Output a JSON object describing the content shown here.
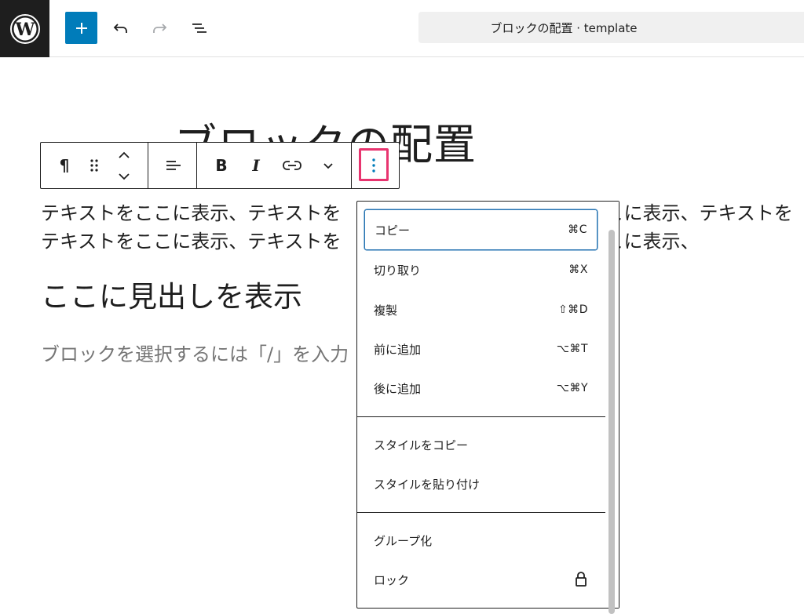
{
  "topbar": {
    "doc_title": "ブロックの配置 · template",
    "icons": [
      "wordpress-logo-icon",
      "plus-icon",
      "undo-icon",
      "redo-icon",
      "list-view-icon"
    ]
  },
  "canvas": {
    "post_title": "ブロックの配置",
    "paragraph_line1": "テキストをここに表示、テキストを　　　　　　　　　　　　　　こに表示、テキストを",
    "paragraph_line2": "テキストをここに表示、テキストを　　　　　　　　　　　　　　こに表示、",
    "heading": "ここに見出しを表示",
    "placeholder": "ブロックを選択するには「/」を入力"
  },
  "block_toolbar": {
    "paragraph_symbol": "¶",
    "bold": "B",
    "italic": "I",
    "icons": [
      "paragraph-icon",
      "drag-handle-icon",
      "move-up-icon",
      "move-down-icon",
      "align-icon",
      "link-icon",
      "chevron-down-icon",
      "more-options-icon"
    ]
  },
  "menu": {
    "group1": [
      {
        "label": "コピー",
        "shortcut": "⌘C"
      },
      {
        "label": "切り取り",
        "shortcut": "⌘X"
      },
      {
        "label": "複製",
        "shortcut": "⇧⌘D"
      },
      {
        "label": "前に追加",
        "shortcut": "⌥⌘T"
      },
      {
        "label": "後に追加",
        "shortcut": "⌥⌘Y"
      }
    ],
    "group2": [
      {
        "label": "スタイルをコピー"
      },
      {
        "label": "スタイルを貼り付け"
      }
    ],
    "group3": [
      {
        "label": "グループ化"
      },
      {
        "label": "ロック"
      }
    ]
  },
  "colors": {
    "accent": "#007cba",
    "highlight": "#e8346f",
    "focus": "#2271b1",
    "text": "#1e1e1e",
    "placeholder": "#757575"
  }
}
